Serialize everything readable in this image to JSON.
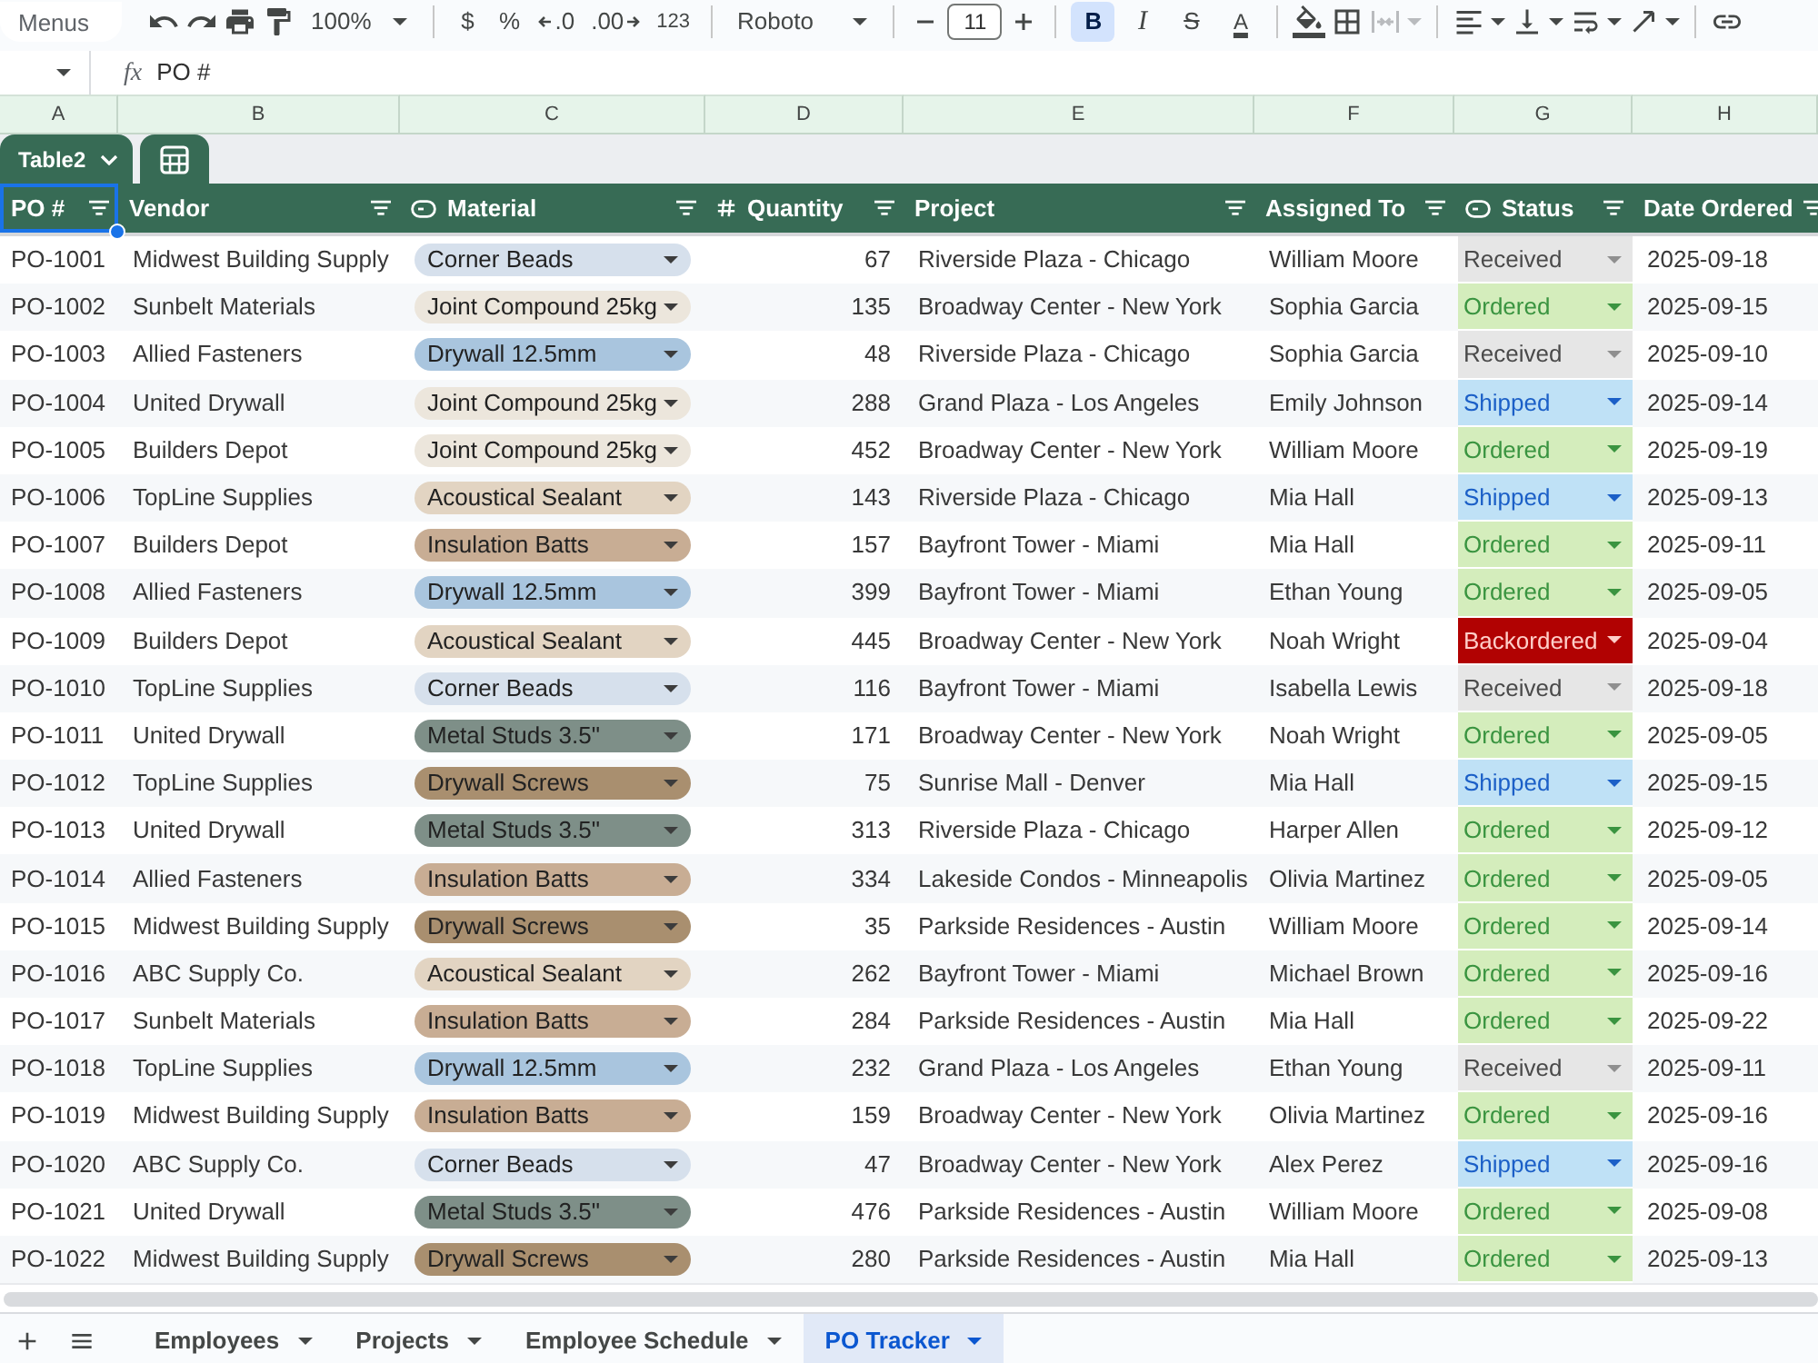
{
  "toolbar": {
    "search": {
      "placeholder": "Menus"
    },
    "zoom": "100%",
    "currency": "$",
    "percent": "%",
    "decrease_decimals": ".0",
    "increase_decimals": ".00",
    "more_formats": "123",
    "font": "Roboto",
    "font_size": "11",
    "format_buttons": [
      {
        "kind": "bold",
        "label": "B",
        "selected": true
      },
      {
        "kind": "italic",
        "label": "I",
        "selected": false
      },
      {
        "kind": "strikethrough",
        "label": "S",
        "selected": false
      },
      {
        "kind": "text_color",
        "label": "A",
        "selected": false
      }
    ],
    "merge_disabled": true
  },
  "formula_bar": {
    "label": "fx",
    "formula": "PO #"
  },
  "column_letters": [
    "A",
    "B",
    "C",
    "D",
    "E",
    "F",
    "G",
    "H"
  ],
  "table": {
    "name": "Table2",
    "columns": [
      {
        "label": "PO #",
        "kind": "text",
        "selected": true
      },
      {
        "label": "Vendor",
        "kind": "text",
        "selected": false
      },
      {
        "label": "Material",
        "kind": "dropdown",
        "selected": false
      },
      {
        "label": "Quantity",
        "kind": "number",
        "selected": false
      },
      {
        "label": "Project",
        "kind": "text",
        "selected": false
      },
      {
        "label": "Assigned To",
        "kind": "text",
        "selected": false
      },
      {
        "label": "Status",
        "kind": "dropdown",
        "selected": false
      },
      {
        "label": "Date Ordered",
        "kind": "text",
        "selected": false
      }
    ],
    "rows": [
      {
        "po": "PO-1001",
        "vendor": "Midwest Building Supply",
        "material": {
          "text": "Corner Beads",
          "color": "#d6e0ec"
        },
        "quantity": "67",
        "project": "Riverside Plaza - Chicago",
        "assigned_to": "William Moore",
        "status": {
          "text": "Received",
          "kind": "received"
        },
        "date_ordered": "2025-09-18"
      },
      {
        "po": "PO-1002",
        "vendor": "Sunbelt Materials",
        "material": {
          "text": "Joint Compound 25kg",
          "color": "#ece6dc"
        },
        "quantity": "135",
        "project": "Broadway Center - New York",
        "assigned_to": "Sophia Garcia",
        "status": {
          "text": "Ordered",
          "kind": "ordered"
        },
        "date_ordered": "2025-09-15"
      },
      {
        "po": "PO-1003",
        "vendor": "Allied Fasteners",
        "material": {
          "text": "Drywall 12.5mm",
          "color": "#a9c5de"
        },
        "quantity": "48",
        "project": "Riverside Plaza - Chicago",
        "assigned_to": "Sophia Garcia",
        "status": {
          "text": "Received",
          "kind": "received"
        },
        "date_ordered": "2025-09-10"
      },
      {
        "po": "PO-1004",
        "vendor": "United Drywall",
        "material": {
          "text": "Joint Compound 25kg",
          "color": "#ece6dc"
        },
        "quantity": "288",
        "project": "Grand Plaza - Los Angeles",
        "assigned_to": "Emily Johnson",
        "status": {
          "text": "Shipped",
          "kind": "shipped"
        },
        "date_ordered": "2025-09-14"
      },
      {
        "po": "PO-1005",
        "vendor": "Builders Depot",
        "material": {
          "text": "Joint Compound 25kg",
          "color": "#ece6dc"
        },
        "quantity": "452",
        "project": "Broadway Center - New York",
        "assigned_to": "William Moore",
        "status": {
          "text": "Ordered",
          "kind": "ordered"
        },
        "date_ordered": "2025-09-19"
      },
      {
        "po": "PO-1006",
        "vendor": "TopLine Supplies",
        "material": {
          "text": "Acoustical Sealant",
          "color": "#e2d4c2"
        },
        "quantity": "143",
        "project": "Riverside Plaza - Chicago",
        "assigned_to": "Mia Hall",
        "status": {
          "text": "Shipped",
          "kind": "shipped"
        },
        "date_ordered": "2025-09-13"
      },
      {
        "po": "PO-1007",
        "vendor": "Builders Depot",
        "material": {
          "text": "Insulation Batts",
          "color": "#c8ad94"
        },
        "quantity": "157",
        "project": "Bayfront Tower - Miami",
        "assigned_to": "Mia Hall",
        "status": {
          "text": "Ordered",
          "kind": "ordered"
        },
        "date_ordered": "2025-09-11"
      },
      {
        "po": "PO-1008",
        "vendor": "Allied Fasteners",
        "material": {
          "text": "Drywall 12.5mm",
          "color": "#a9c5de"
        },
        "quantity": "399",
        "project": "Bayfront Tower - Miami",
        "assigned_to": "Ethan Young",
        "status": {
          "text": "Ordered",
          "kind": "ordered"
        },
        "date_ordered": "2025-09-05"
      },
      {
        "po": "PO-1009",
        "vendor": "Builders Depot",
        "material": {
          "text": "Acoustical Sealant",
          "color": "#e2d4c2"
        },
        "quantity": "445",
        "project": "Broadway Center - New York",
        "assigned_to": "Noah Wright",
        "status": {
          "text": "Backordered",
          "kind": "backordered"
        },
        "date_ordered": "2025-09-04"
      },
      {
        "po": "PO-1010",
        "vendor": "TopLine Supplies",
        "material": {
          "text": "Corner Beads",
          "color": "#d6e0ec"
        },
        "quantity": "116",
        "project": "Bayfront Tower - Miami",
        "assigned_to": "Isabella Lewis",
        "status": {
          "text": "Received",
          "kind": "received"
        },
        "date_ordered": "2025-09-18"
      },
      {
        "po": "PO-1011",
        "vendor": "United Drywall",
        "material": {
          "text": "Metal Studs 3.5\"",
          "color": "#7e8f88"
        },
        "quantity": "171",
        "project": "Broadway Center - New York",
        "assigned_to": "Noah Wright",
        "status": {
          "text": "Ordered",
          "kind": "ordered"
        },
        "date_ordered": "2025-09-05"
      },
      {
        "po": "PO-1012",
        "vendor": "TopLine Supplies",
        "material": {
          "text": "Drywall Screws",
          "color": "#a98f6f"
        },
        "quantity": "75",
        "project": "Sunrise Mall - Denver",
        "assigned_to": "Mia Hall",
        "status": {
          "text": "Shipped",
          "kind": "shipped"
        },
        "date_ordered": "2025-09-15"
      },
      {
        "po": "PO-1013",
        "vendor": "United Drywall",
        "material": {
          "text": "Metal Studs 3.5\"",
          "color": "#7e8f88"
        },
        "quantity": "313",
        "project": "Riverside Plaza - Chicago",
        "assigned_to": "Harper Allen",
        "status": {
          "text": "Ordered",
          "kind": "ordered"
        },
        "date_ordered": "2025-09-12"
      },
      {
        "po": "PO-1014",
        "vendor": "Allied Fasteners",
        "material": {
          "text": "Insulation Batts",
          "color": "#c8ad94"
        },
        "quantity": "334",
        "project": "Lakeside Condos - Minneapolis",
        "assigned_to": "Olivia Martinez",
        "status": {
          "text": "Ordered",
          "kind": "ordered"
        },
        "date_ordered": "2025-09-05"
      },
      {
        "po": "PO-1015",
        "vendor": "Midwest Building Supply",
        "material": {
          "text": "Drywall Screws",
          "color": "#a98f6f"
        },
        "quantity": "35",
        "project": "Parkside Residences - Austin",
        "assigned_to": "William Moore",
        "status": {
          "text": "Ordered",
          "kind": "ordered"
        },
        "date_ordered": "2025-09-14"
      },
      {
        "po": "PO-1016",
        "vendor": "ABC Supply Co.",
        "material": {
          "text": "Acoustical Sealant",
          "color": "#e2d4c2"
        },
        "quantity": "262",
        "project": "Bayfront Tower - Miami",
        "assigned_to": "Michael Brown",
        "status": {
          "text": "Ordered",
          "kind": "ordered"
        },
        "date_ordered": "2025-09-16"
      },
      {
        "po": "PO-1017",
        "vendor": "Sunbelt Materials",
        "material": {
          "text": "Insulation Batts",
          "color": "#c8ad94"
        },
        "quantity": "284",
        "project": "Parkside Residences - Austin",
        "assigned_to": "Mia Hall",
        "status": {
          "text": "Ordered",
          "kind": "ordered"
        },
        "date_ordered": "2025-09-22"
      },
      {
        "po": "PO-1018",
        "vendor": "TopLine Supplies",
        "material": {
          "text": "Drywall 12.5mm",
          "color": "#a9c5de"
        },
        "quantity": "232",
        "project": "Grand Plaza - Los Angeles",
        "assigned_to": "Ethan Young",
        "status": {
          "text": "Received",
          "kind": "received"
        },
        "date_ordered": "2025-09-11"
      },
      {
        "po": "PO-1019",
        "vendor": "Midwest Building Supply",
        "material": {
          "text": "Insulation Batts",
          "color": "#c8ad94"
        },
        "quantity": "159",
        "project": "Broadway Center - New York",
        "assigned_to": "Olivia Martinez",
        "status": {
          "text": "Ordered",
          "kind": "ordered"
        },
        "date_ordered": "2025-09-16"
      },
      {
        "po": "PO-1020",
        "vendor": "ABC Supply Co.",
        "material": {
          "text": "Corner Beads",
          "color": "#d6e0ec"
        },
        "quantity": "47",
        "project": "Broadway Center - New York",
        "assigned_to": "Alex Perez",
        "status": {
          "text": "Shipped",
          "kind": "shipped"
        },
        "date_ordered": "2025-09-16"
      },
      {
        "po": "PO-1021",
        "vendor": "United Drywall",
        "material": {
          "text": "Metal Studs 3.5\"",
          "color": "#7e8f88"
        },
        "quantity": "476",
        "project": "Parkside Residences - Austin",
        "assigned_to": "William Moore",
        "status": {
          "text": "Ordered",
          "kind": "ordered"
        },
        "date_ordered": "2025-09-08"
      },
      {
        "po": "PO-1022",
        "vendor": "Midwest Building Supply",
        "material": {
          "text": "Drywall Screws",
          "color": "#a98f6f"
        },
        "quantity": "280",
        "project": "Parkside Residences - Austin",
        "assigned_to": "Mia Hall",
        "status": {
          "text": "Ordered",
          "kind": "ordered"
        },
        "date_ordered": "2025-09-13"
      }
    ]
  },
  "sheet_tabs": [
    {
      "label": "Employees",
      "selected": false
    },
    {
      "label": "Projects",
      "selected": false
    },
    {
      "label": "Employee Schedule",
      "selected": false
    },
    {
      "label": "PO Tracker",
      "selected": true
    }
  ]
}
